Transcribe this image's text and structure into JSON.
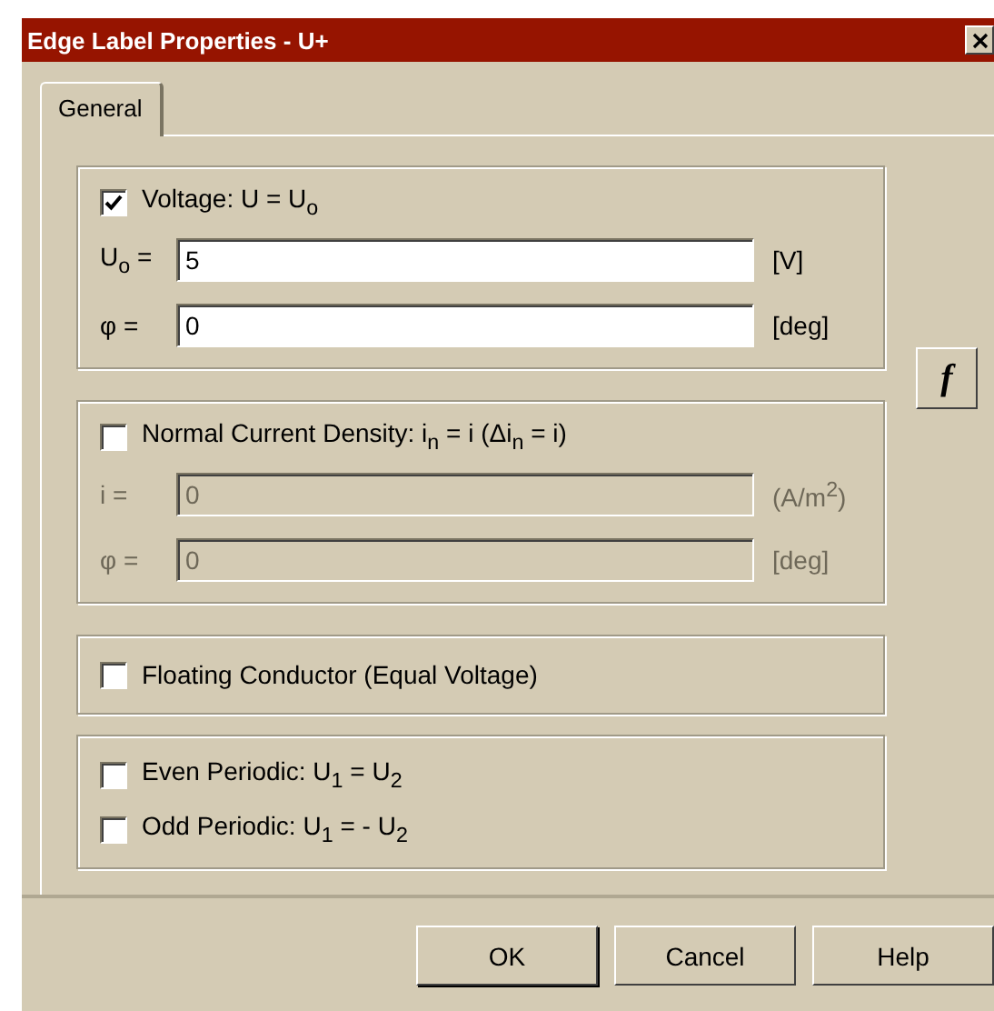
{
  "window": {
    "title": "Edge Label Properties - U+"
  },
  "tabs": [
    {
      "label": "General",
      "selected": true
    }
  ],
  "groups": [
    {
      "checkbox": {
        "label": "Voltage: U = U$_{o}$",
        "checked": true
      },
      "fields": [
        {
          "label": "U$_{o}$ =",
          "value": "5",
          "unit": "[V]",
          "disabled": false
        },
        {
          "label": "φ =",
          "value": "0",
          "unit": "[deg]",
          "disabled": false
        }
      ]
    },
    {
      "checkbox": {
        "label": "Normal Current Density: i$_{n}$ = i (Δi$_{n}$ = i)",
        "checked": false
      },
      "fields": [
        {
          "label": "i =",
          "value": "0",
          "unit": "(A/m$^{2}$)",
          "disabled": true
        },
        {
          "label": "φ =",
          "value": "0",
          "unit": "[deg]",
          "disabled": true
        }
      ]
    },
    {
      "checkboxes": [
        {
          "label": "Floating Conductor  (Equal Voltage)",
          "checked": false
        }
      ]
    },
    {
      "checkboxes": [
        {
          "label": "Even Periodic: U$_{1}$ = U$_{2}$",
          "checked": false
        },
        {
          "label": "Odd Periodic: U$_{1}$ = - U$_{2}$",
          "checked": false
        }
      ]
    }
  ],
  "function_button": {
    "label": "f"
  },
  "buttons": [
    "OK",
    "Cancel",
    "Help"
  ]
}
